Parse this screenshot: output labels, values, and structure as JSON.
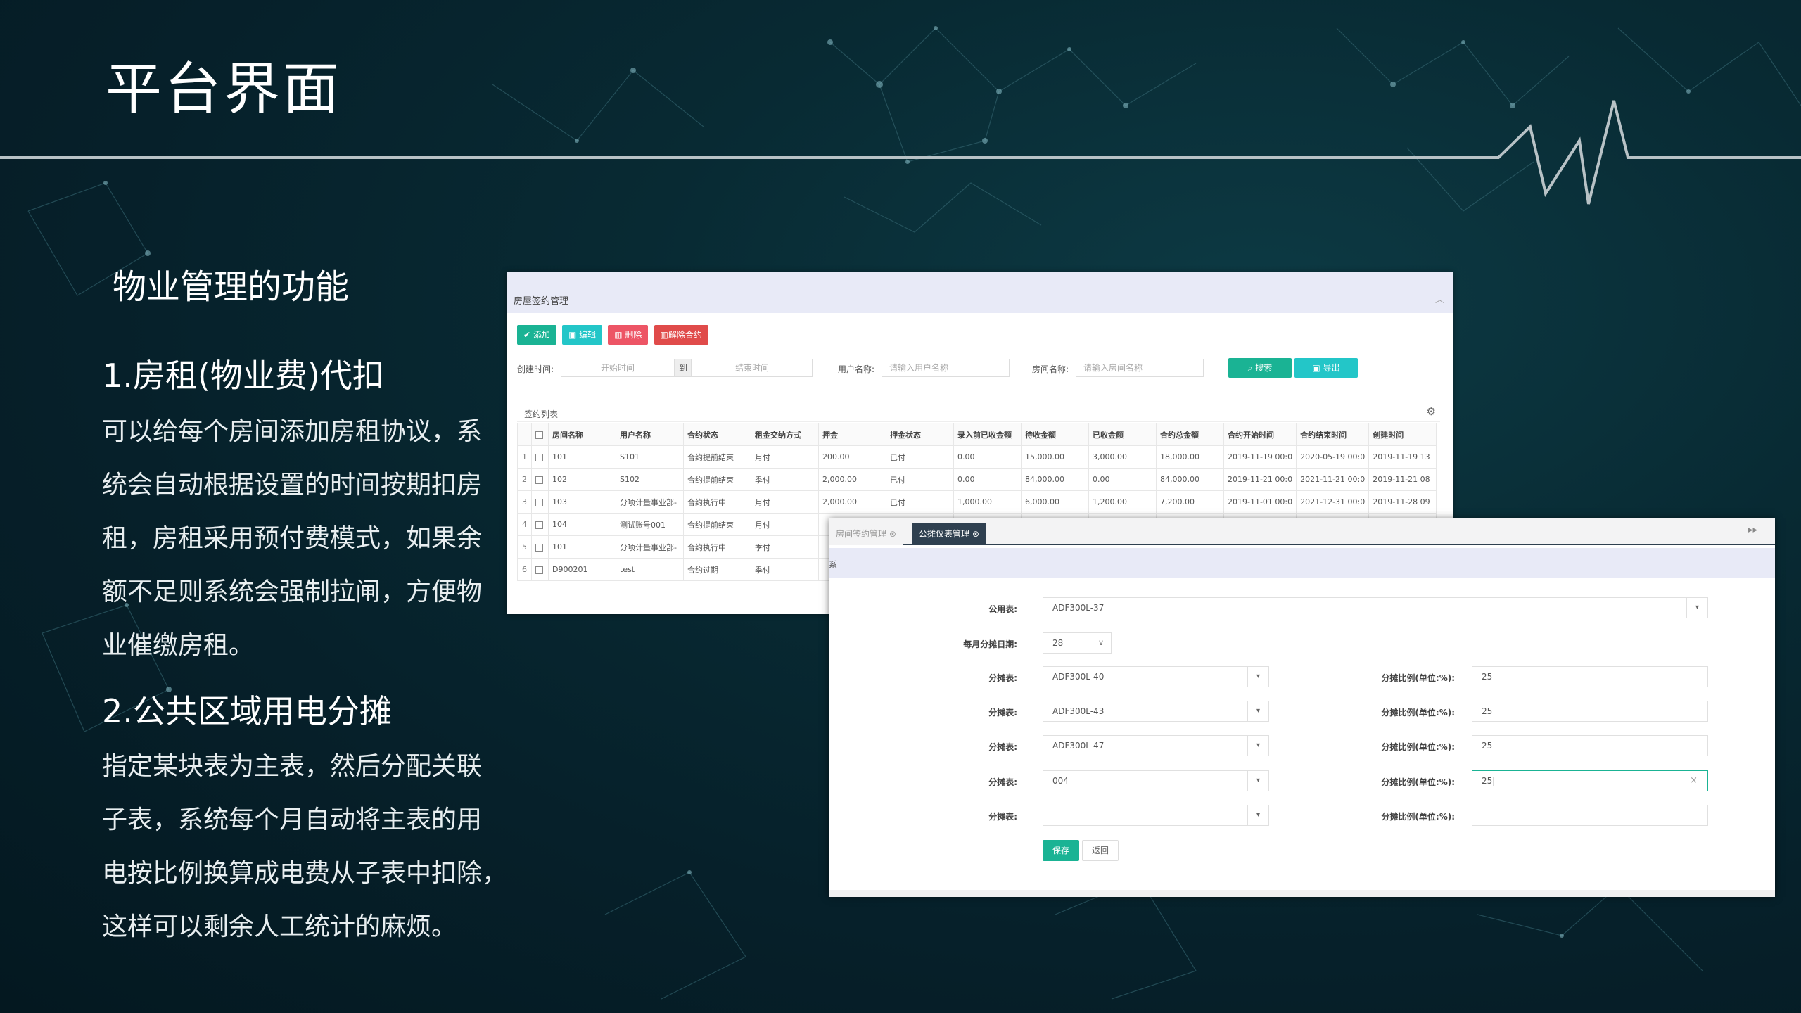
{
  "slide": {
    "title": "平台界面",
    "subtitle": "物业管理的功能",
    "section1_heading": "1.房租(物业费)代扣",
    "section1_lines": [
      "可以给每个房间添加房租协议，系",
      "统会自动根据设置的时间按期扣房",
      "租，房租采用预付费模式，如果余",
      "额不足则系统会强制拉闸，方便物",
      "业催缴房租。"
    ],
    "section2_heading": "2.公共区域用电分摊",
    "section2_lines": [
      "指定某块表为主表，然后分配关联",
      "子表，系统每个月自动将主表的用",
      "电按比例换算成电费从子表中扣除，",
      "这样可以剩余人工统计的麻烦。"
    ]
  },
  "contract_window": {
    "panel_title": "房屋签约管理",
    "toolbar": {
      "add": "✔ 添加",
      "edit": "编辑",
      "delete": "删除",
      "terminate": "解除合约"
    },
    "filters": {
      "created_label": "创建时间:",
      "start_placeholder": "开始时间",
      "to_label": "到",
      "end_placeholder": "结束时间",
      "user_label": "用户名称:",
      "user_placeholder": "请输入用户名称",
      "room_label": "房间名称:",
      "room_placeholder": "请输入房间名称",
      "search_button": "搜索",
      "export_button": "导出"
    },
    "list_title": "签约列表",
    "columns": [
      "房间名称",
      "用户名称",
      "合约状态",
      "租金交纳方式",
      "押金",
      "押金状态",
      "录入前已收金额",
      "待收金额",
      "已收金额",
      "合约总金额",
      "合约开始时间",
      "合约结束时间",
      "创建时间"
    ],
    "rows": [
      [
        "1",
        "101",
        "S101",
        "合约提前结束",
        "月付",
        "200.00",
        "已付",
        "0.00",
        "15,000.00",
        "3,000.00",
        "18,000.00",
        "2019-11-19 00:0",
        "2020-05-19 00:0",
        "2019-11-19 13"
      ],
      [
        "2",
        "102",
        "S102",
        "合约提前结束",
        "季付",
        "2,000.00",
        "已付",
        "0.00",
        "84,000.00",
        "0.00",
        "84,000.00",
        "2019-11-21 00:0",
        "2021-11-21 00:0",
        "2019-11-21 08"
      ],
      [
        "3",
        "103",
        "分项计量事业部-",
        "合约执行中",
        "月付",
        "2,000.00",
        "已付",
        "1,000.00",
        "6,000.00",
        "1,200.00",
        "7,200.00",
        "2019-11-01 00:0",
        "2021-12-31 00:0",
        "2019-11-28 09"
      ],
      [
        "4",
        "104",
        "测试账号001",
        "合约提前结束",
        "月付",
        "",
        "",
        "",
        "",
        "",
        "",
        "",
        "",
        ""
      ],
      [
        "5",
        "101",
        "分项计量事业部-",
        "合约执行中",
        "季付",
        "",
        "",
        "",
        "",
        "",
        "",
        "",
        "",
        ""
      ],
      [
        "6",
        "D900201",
        "test",
        "合约过期",
        "季付",
        "",
        "",
        "",
        "",
        "",
        "",
        "",
        "",
        ""
      ]
    ]
  },
  "meter_window": {
    "tabs": [
      "房间签约管理",
      "公摊仪表管理"
    ],
    "band_fragment": "系",
    "form": {
      "public_meter_label": "公用表:",
      "public_meter_value": "ADF300L-37",
      "day_label": "每月分摊日期:",
      "day_value": "28",
      "sub_meter_label": "分摊表:",
      "ratio_label": "分摊比例(单位:%):",
      "sub_meters": [
        "ADF300L-40",
        "ADF300L-43",
        "ADF300L-47",
        "004",
        ""
      ],
      "ratios": [
        "25",
        "25",
        "25",
        "25",
        ""
      ],
      "save": "保存",
      "back": "返回"
    }
  },
  "colors": {
    "primary": "#1ab394",
    "info": "#23c6c8",
    "danger": "#ed5565",
    "nav_dark": "#2f4050",
    "panel_head": "#e8eaf7"
  }
}
